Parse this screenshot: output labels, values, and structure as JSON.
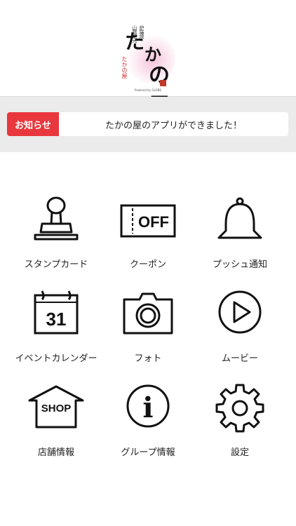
{
  "logo": {
    "main_chars": [
      "た",
      "か",
      "の屋"
    ],
    "small_left": "山陰地元",
    "small_right": "炉端焼",
    "red_text": "たかの屋",
    "powered_text": "Powered by GLOBE"
  },
  "notice": {
    "tag": "お知らせ",
    "message": "たかの屋のアプリができました！"
  },
  "menu": [
    {
      "label": "スタンプカード",
      "icon": "stamp-icon"
    },
    {
      "label": "クーポン",
      "icon": "coupon-icon",
      "icon_text": "OFF"
    },
    {
      "label": "プッシュ通知",
      "icon": "bell-icon"
    },
    {
      "label": "イベントカレンダー",
      "icon": "calendar-icon",
      "icon_text": "31"
    },
    {
      "label": "フォト",
      "icon": "camera-icon"
    },
    {
      "label": "ムービー",
      "icon": "play-icon"
    },
    {
      "label": "店舗情報",
      "icon": "shop-icon",
      "icon_text": "SHOP"
    },
    {
      "label": "グループ情報",
      "icon": "info-icon",
      "icon_text": "i"
    },
    {
      "label": "設定",
      "icon": "gear-icon"
    }
  ],
  "colors": {
    "accent": "#e8373d",
    "band": "#ebebeb",
    "icon_stroke": "#111111"
  }
}
